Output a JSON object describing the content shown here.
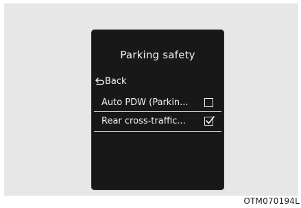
{
  "screen": {
    "title": "Parking safety",
    "items": [
      {
        "icon": "back-arrow-icon",
        "label": "Back"
      },
      {
        "label": "Auto PDW (Parkin...",
        "checked": false
      },
      {
        "label": "Rear cross-traffic...",
        "checked": true,
        "selected": true
      }
    ]
  },
  "figure_code": "OTM070194L",
  "colors": {
    "screen_background": "#181818",
    "text": "#f2f2f2",
    "frame_background": "#e7e7e7"
  }
}
